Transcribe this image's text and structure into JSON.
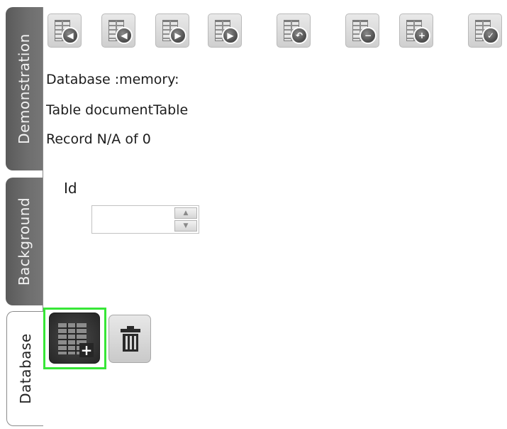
{
  "tabs": [
    {
      "label": "Demonstration",
      "active": false
    },
    {
      "label": "Background",
      "active": false
    },
    {
      "label": "Database",
      "active": true
    }
  ],
  "toolbar": {
    "buttons": [
      {
        "name": "first-record-button",
        "icon": "first-record-icon",
        "glyph": "◀"
      },
      {
        "name": "previous-record-button",
        "icon": "previous-record-icon",
        "glyph": "◀"
      },
      {
        "name": "next-record-button",
        "icon": "next-record-icon",
        "glyph": "▶"
      },
      {
        "name": "last-record-button",
        "icon": "last-record-icon",
        "glyph": "▶"
      },
      {
        "name": "undo-button",
        "icon": "undo-icon",
        "glyph": "↶"
      },
      {
        "name": "delete-record-button",
        "icon": "minus-icon",
        "glyph": "−"
      },
      {
        "name": "add-record-button",
        "icon": "plus-icon",
        "glyph": "+"
      },
      {
        "name": "commit-button",
        "icon": "checkmark-icon",
        "glyph": "✓"
      }
    ]
  },
  "info": {
    "database": "Database :memory:",
    "table": "Table documentTable",
    "record": "Record N/A of 0"
  },
  "form": {
    "id_label": "Id",
    "id_value": "",
    "spin_up": "▲",
    "spin_down": "▼"
  },
  "colors": {
    "focus_ring": "#37e637",
    "tab_inactive": "#6a6a6a",
    "add_button_bg": "#2e2e2e"
  }
}
